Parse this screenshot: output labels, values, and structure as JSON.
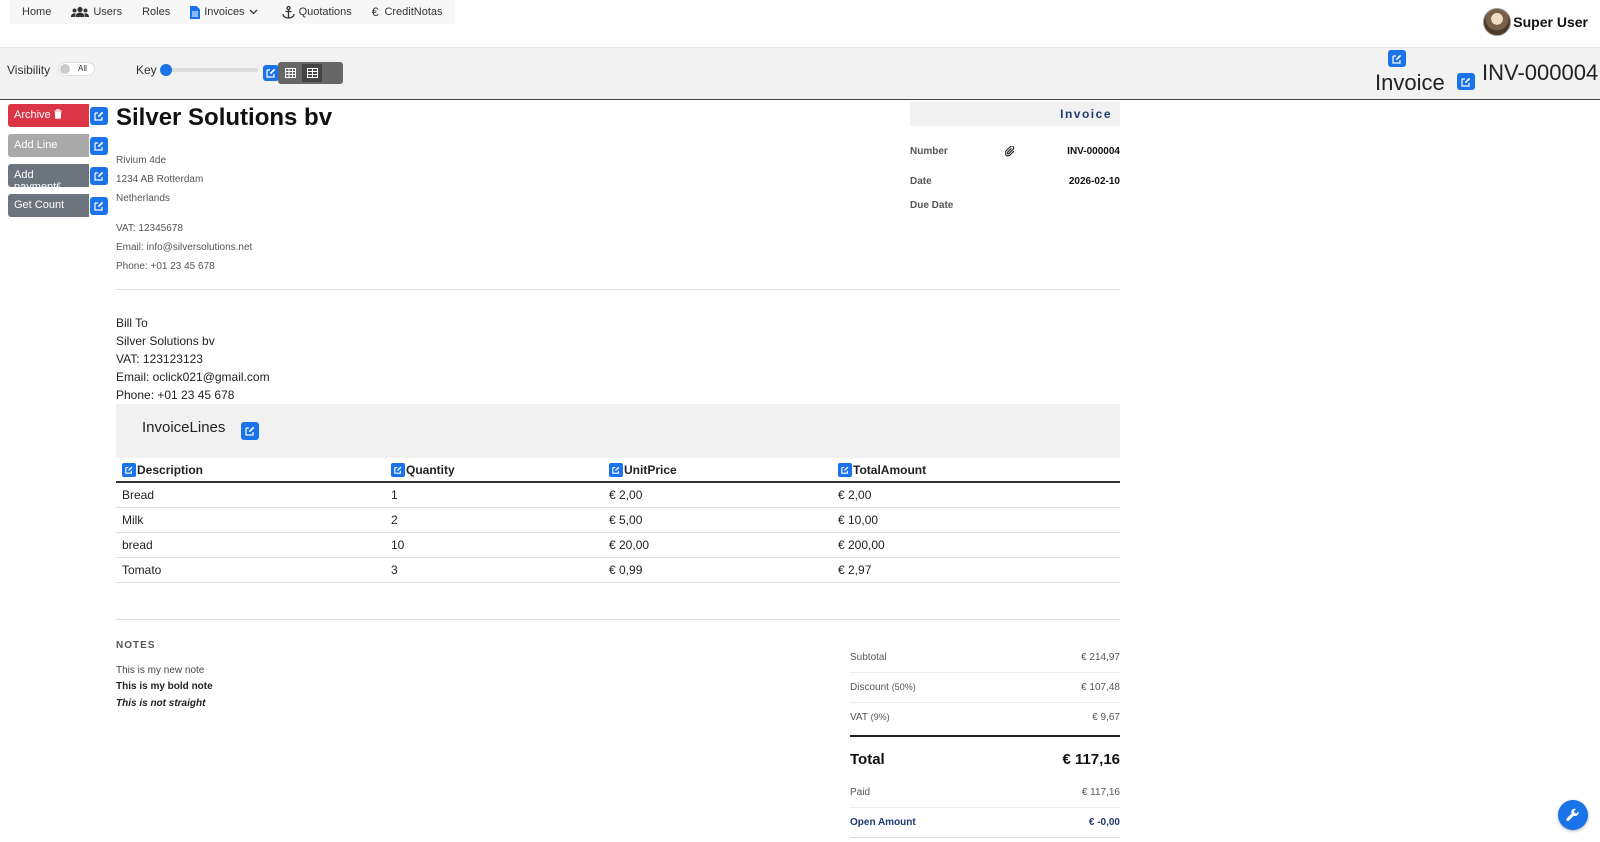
{
  "nav": {
    "items": [
      {
        "label": "Home",
        "icon": ""
      },
      {
        "label": "Users",
        "icon": "users-icon"
      },
      {
        "label": "Roles",
        "icon": ""
      },
      {
        "label": "Invoices",
        "icon": "document-icon"
      },
      {
        "label": "Quotations",
        "icon": "anchor-icon"
      },
      {
        "label": "CreditNotas",
        "icon": "euro-icon"
      }
    ],
    "user_name": "Super User"
  },
  "toolbar": {
    "visibility_label": "Visibility",
    "visibility_value": "All",
    "key_label": "Key",
    "doc_type": "Invoice",
    "doc_number": "INV-000004"
  },
  "actions": {
    "archive": "Archive",
    "add_line": "Add Line",
    "add_payment": "Add payment",
    "get_count": "Get Count"
  },
  "company": {
    "name": "Silver Solutions bv",
    "street": "Rivium 4de",
    "city": "1234 AB Rotterdam",
    "country": "Netherlands",
    "vat": "VAT: 12345678",
    "email": "Email: info@silversolutions.net",
    "phone": "Phone: +01 23 45 678"
  },
  "meta": {
    "heading": "Invoice",
    "number_label": "Number",
    "number_value": "INV-000004",
    "date_label": "Date",
    "date_value": "2026-02-10",
    "due_label": "Due Date",
    "due_value": ""
  },
  "bill_to": {
    "title": "Bill To",
    "name": "Silver Solutions bv",
    "vat": "VAT: 123123123",
    "email": "Email: oclick021@gmail.com",
    "phone": "Phone: +01 23 45 678"
  },
  "lines": {
    "title": "InvoiceLines",
    "headers": [
      "Description",
      "Quantity",
      "UnitPrice",
      "TotalAmount"
    ],
    "rows": [
      [
        "Bread",
        "1",
        "€ 2,00",
        "€ 2,00"
      ],
      [
        "Milk",
        "2",
        "€ 5,00",
        "€ 10,00"
      ],
      [
        "bread",
        "10",
        "€ 20,00",
        "€ 200,00"
      ],
      [
        "Tomato",
        "3",
        "€ 0,99",
        "€ 2,97"
      ]
    ]
  },
  "notes": {
    "title": "NOTES",
    "line1": "This is my new note",
    "line2": "This is my bold note",
    "line3": "This is not straight"
  },
  "totals": {
    "subtotal_label": "Subtotal",
    "subtotal_value": "€ 214,97",
    "discount_label": "Discount",
    "discount_pct": "(50%)",
    "discount_value": "€ 107,48",
    "vat_label": "VAT",
    "vat_pct": "(9%)",
    "vat_value": "€ 9,67",
    "total_label": "Total",
    "total_value": "€ 117,16",
    "paid_label": "Paid",
    "paid_value": "€ 117,16",
    "open_label": "Open Amount",
    "open_value": "€ -0,00"
  },
  "colors": {
    "primary": "#1a73e8",
    "archive": "#dc3545",
    "secondary": "#6c757d",
    "accent_navy": "#1f3a6e"
  }
}
